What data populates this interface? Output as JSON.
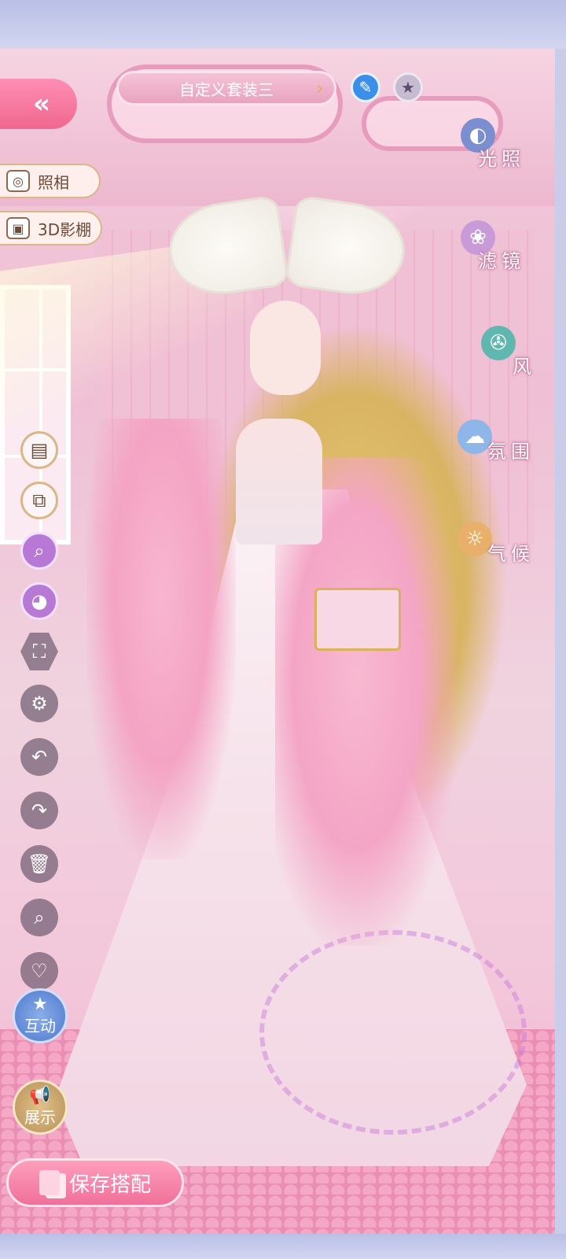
{
  "header": {
    "back_icon": "«",
    "outfit_name": "自定义套装三",
    "arrow_icon": "›",
    "edit_icon": "✎",
    "favorite_icon": "★"
  },
  "left_panel": {
    "photo_label": "照相",
    "photo_icon": "◎",
    "studio_label": "3D影棚",
    "studio_icon": "▣"
  },
  "environment": [
    {
      "label": "光照",
      "icon": "◐",
      "color": "#7b8fd0"
    },
    {
      "label": "滤镜",
      "icon": "❀",
      "color": "#c99ad8"
    },
    {
      "label": "风",
      "icon": "✇",
      "color": "#5fb7b0"
    },
    {
      "label": "氛围",
      "icon": "☁",
      "color": "#8fb6e8"
    },
    {
      "label": "气候",
      "icon": "☼",
      "color": "#e8b06a"
    }
  ],
  "tools": [
    {
      "name": "wardrobe",
      "icon": "▤",
      "style": "light"
    },
    {
      "name": "duplicate",
      "icon": "⧉",
      "style": "light"
    },
    {
      "name": "search-style",
      "icon": "⌕",
      "style": "purple"
    },
    {
      "name": "palette",
      "icon": "◕",
      "style": "purple"
    },
    {
      "name": "fullscreen",
      "icon": "⛶",
      "style": "hex"
    },
    {
      "name": "settings",
      "icon": "⚙",
      "style": "dark"
    },
    {
      "name": "undo",
      "icon": "↶",
      "style": "dark"
    },
    {
      "name": "redo",
      "icon": "↷",
      "style": "dark"
    },
    {
      "name": "delete",
      "icon": "🗑",
      "style": "dark"
    },
    {
      "name": "zoom",
      "icon": "⌕",
      "style": "dark"
    },
    {
      "name": "like",
      "icon": "♡",
      "style": "dark"
    }
  ],
  "actions": {
    "interact_label": "互动",
    "interact_icon": "★",
    "showcase_label": "展示",
    "showcase_icon": "📢"
  },
  "footer": {
    "save_label": "保存搭配"
  },
  "colors": {
    "accent_pink": "#f0678f",
    "frame": "#c9cde9",
    "gold": "#d9b25a"
  }
}
